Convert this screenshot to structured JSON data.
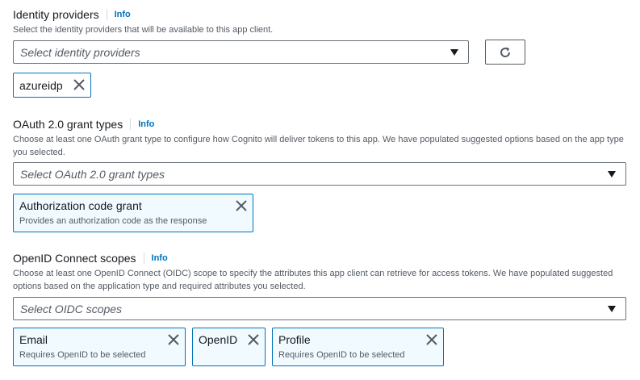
{
  "identity": {
    "label": "Identity providers",
    "info": "Info",
    "description": "Select the identity providers that will be available to this app client.",
    "placeholder": "Select identity providers",
    "tokens": [
      {
        "label": "azureidp"
      }
    ]
  },
  "oauth": {
    "label": "OAuth 2.0 grant types",
    "info": "Info",
    "description": "Choose at least one OAuth grant type to configure how Cognito will deliver tokens to this app. We have populated suggested options based on the app type you selected.",
    "placeholder": "Select OAuth 2.0 grant types",
    "tokens": [
      {
        "label": "Authorization code grant",
        "desc": "Provides an authorization code as the response"
      }
    ]
  },
  "oidc": {
    "label": "OpenID Connect scopes",
    "info": "Info",
    "description": "Choose at least one OpenID Connect (OIDC) scope to specify the attributes this app client can retrieve for access tokens. We have populated suggested options based on the application type and required attributes you selected.",
    "placeholder": "Select OIDC scopes",
    "tokens": [
      {
        "label": "Email",
        "desc": "Requires OpenID to be selected"
      },
      {
        "label": "OpenID"
      },
      {
        "label": "Profile",
        "desc": "Requires OpenID to be selected"
      }
    ]
  },
  "icons": {
    "remove": "close-icon",
    "refresh": "refresh-icon",
    "dropdown": "caret-down-icon"
  },
  "colors": {
    "link": "#0073bb",
    "token_border": "#0073bb",
    "token_bg": "#f1faff"
  }
}
